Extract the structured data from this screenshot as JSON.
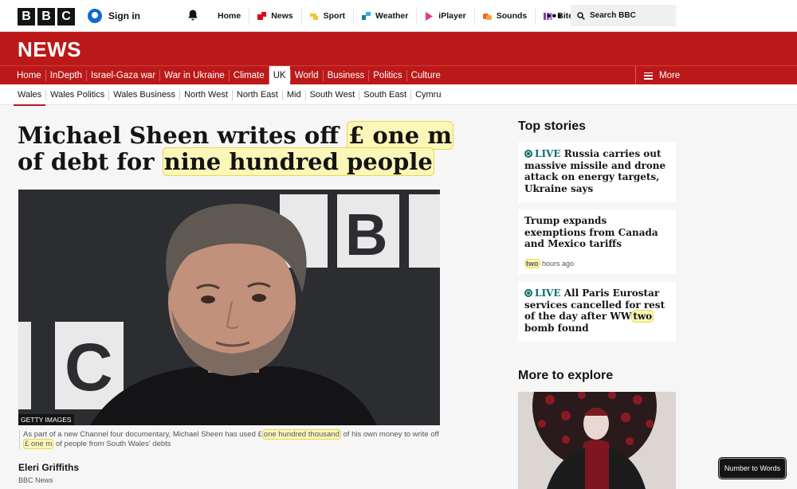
{
  "topbar": {
    "logo_letters": [
      "B",
      "B",
      "C"
    ],
    "sign_in": "Sign in",
    "nav": [
      {
        "label": "Home",
        "icon": "none"
      },
      {
        "label": "News",
        "icon": "news-icon",
        "color": "#e3001b"
      },
      {
        "label": "Sport",
        "icon": "sport-icon",
        "color": "#f9c12f"
      },
      {
        "label": "Weather",
        "icon": "weather-icon",
        "color": "#1e7ba8"
      },
      {
        "label": "iPlayer",
        "icon": "iplayer-icon",
        "color": "#e03b8b"
      },
      {
        "label": "Sounds",
        "icon": "sounds-icon",
        "color": "#f26522"
      },
      {
        "label": "Bitesize",
        "icon": "bitesize-icon",
        "color": "#7b3fbf"
      }
    ],
    "more_glyph": "•••",
    "search_label": "Search BBC"
  },
  "news": {
    "title": "NEWS",
    "nav": [
      "Home",
      "InDepth",
      "Israel-Gaza war",
      "War in Ukraine",
      "Climate",
      "UK",
      "World",
      "Business",
      "Politics",
      "Culture"
    ],
    "active_nav": "UK",
    "more_label": "More",
    "subnav": [
      "Wales",
      "Wales Politics",
      "Wales Business",
      "North West",
      "North East",
      "Mid",
      "South West",
      "South East",
      "Cymru"
    ],
    "active_subnav": "Wales"
  },
  "article": {
    "headline_part1": "Michael Sheen writes off ",
    "headline_hl1": "£ one m",
    "headline_part2": " of debt for ",
    "headline_hl2": "nine hundred people",
    "image_credit": "GETTY IMAGES",
    "caption_part1": "As part of a new Channel four documentary, Michael Sheen has used £",
    "caption_hl1": "one hundred thousand",
    "caption_part2": " of his own money to write off ",
    "caption_hl2": "£ one m",
    "caption_part3": " of people from South Wales' debts",
    "author": "Eleri Griffiths",
    "author_org": "BBC News"
  },
  "sidebar": {
    "top_stories_title": "Top stories",
    "stories": [
      {
        "live": "LIVE",
        "title": " Russia carries out massive missile and drone attack on energy targets, Ukraine says"
      },
      {
        "title": "Trump expands exemptions from Canada and Mexico tariffs",
        "time_hl": "two",
        "time_rest": " hours ago"
      },
      {
        "live": "LIVE",
        "title_part1": " All Paris Eurostar services cancelled for rest of the day after WW",
        "title_hl": "two",
        "title_part2": " bomb found"
      }
    ],
    "more_to_explore_title": "More to explore"
  },
  "extension": {
    "button_label": "Number to Words"
  },
  "colors": {
    "bbc_red": "#bb1919",
    "live_teal": "#0c6e6e",
    "highlight_fill": "#fbf7b8",
    "highlight_border": "#e8d84c"
  }
}
